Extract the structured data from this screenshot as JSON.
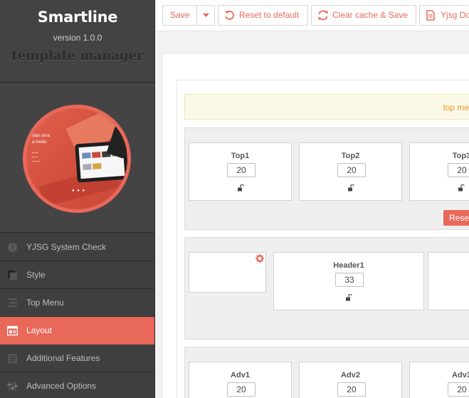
{
  "brand": {
    "title": "Smartline",
    "version": "version 1.0.0",
    "subtitle": "template manager"
  },
  "preview": {
    "text_line1": "stas urna",
    "text_line2": "a mollis"
  },
  "nav": {
    "items": [
      {
        "label": "YJSG System Check",
        "icon": "info-icon",
        "active": false
      },
      {
        "label": "Style",
        "icon": "style-icon",
        "active": false
      },
      {
        "label": "Top Menu",
        "icon": "menu-icon",
        "active": false
      },
      {
        "label": "Layout",
        "icon": "layout-icon",
        "active": true
      },
      {
        "label": "Additional Features",
        "icon": "features-icon",
        "active": false
      },
      {
        "label": "Advanced Options",
        "icon": "sliders-icon",
        "active": false
      }
    ]
  },
  "toolbar": {
    "save": "Save",
    "reset_default": "Reset to default",
    "clear_cache": "Clear cache & Save",
    "docs": "Yjsg Do"
  },
  "notice": "top me",
  "rows": {
    "top": {
      "cards": [
        {
          "name": "Top1",
          "value": "20"
        },
        {
          "name": "Top2",
          "value": "20"
        },
        {
          "name": "Top3",
          "value": "20"
        }
      ],
      "reset_label": "Rese"
    },
    "header": {
      "cards": [
        {
          "name": "Header1",
          "value": "33"
        }
      ]
    },
    "adv": {
      "cards": [
        {
          "name": "Adv1",
          "value": "20"
        },
        {
          "name": "Adv2",
          "value": "20"
        },
        {
          "name": "Adv3",
          "value": "20"
        }
      ]
    }
  },
  "colors": {
    "accent": "#e8685a",
    "sidebar": "#3d3d3d",
    "notice_text": "#e59a2c"
  }
}
